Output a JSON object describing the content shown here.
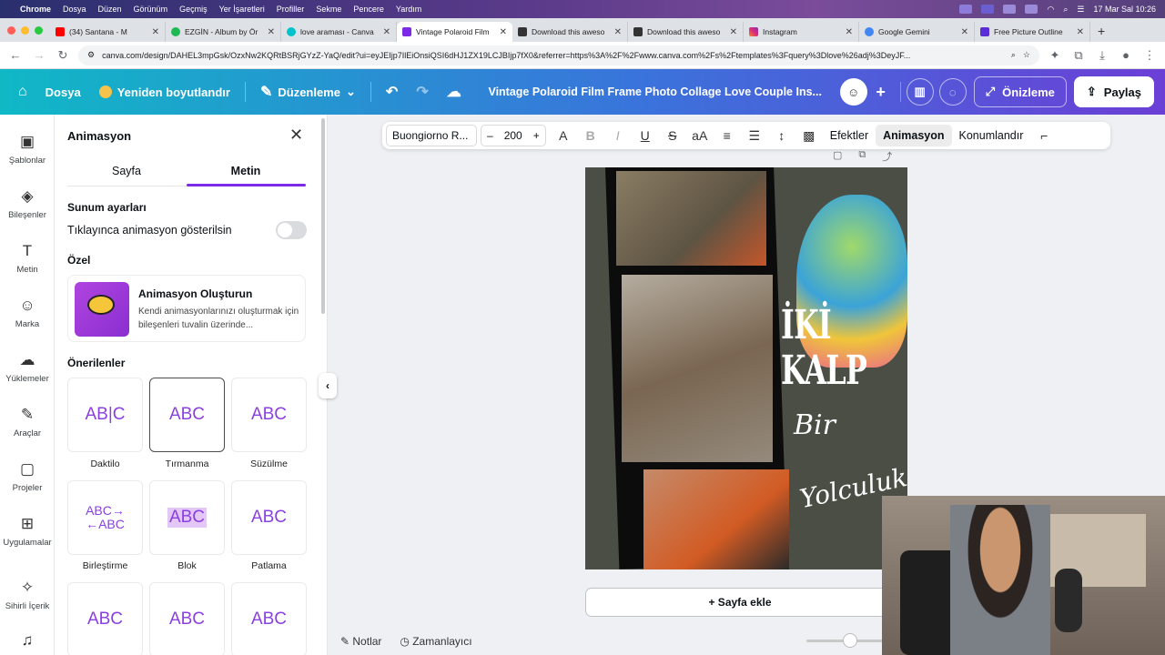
{
  "mac_menu": {
    "apple": "",
    "app": "Chrome",
    "items": [
      "Dosya",
      "Düzen",
      "Görünüm",
      "Geçmiş",
      "Yer İşaretleri",
      "Profiller",
      "Sekme",
      "Pencere",
      "Yardım"
    ],
    "clock": "17 Mar Sal  10:26"
  },
  "tabs": [
    {
      "title": "(34) Santana - M",
      "color": "#ff0000"
    },
    {
      "title": "EZGİN - Album by Ör",
      "color": "#1db954"
    },
    {
      "title": "love araması - Canva",
      "color": "#00c4cc"
    },
    {
      "title": "Vintage Polaroid Film",
      "color": "#7d2ae8",
      "active": true
    },
    {
      "title": "Download this aweso",
      "color": "#333333"
    },
    {
      "title": "Download this aweso",
      "color": "#333333"
    },
    {
      "title": "Instagram",
      "color": "#e1306c"
    },
    {
      "title": "Google Gemini",
      "color": "#4285f4"
    },
    {
      "title": "Free Picture Outline",
      "color": "#5a2dd6"
    }
  ],
  "url": "canva.com/design/DAHEL3mpGsk/OzxNw2KQRtBSRjGYzZ-YaQ/edit?ui=eyJEIjp7IlEiOnsiQSI6dHJ1ZX19LCJBIjp7fX0&referrer=https%3A%2F%2Fwww.canva.com%2Fs%2Ftemplates%3Fquery%3Dlove%26adj%3DeyJF...",
  "header": {
    "file": "Dosya",
    "resize": "Yeniden boyutlandır",
    "edit": "Düzenleme",
    "doc_title": "Vintage Polaroid Film Frame Photo Collage Love Couple Ins...",
    "preview": "Önizleme",
    "share": "Paylaş"
  },
  "rail": [
    {
      "label": "Şablonlar",
      "icon": "▣"
    },
    {
      "label": "Bileşenler",
      "icon": "◈"
    },
    {
      "label": "Metin",
      "icon": "T"
    },
    {
      "label": "Marka",
      "icon": "☺"
    },
    {
      "label": "Yüklemeler",
      "icon": "☁"
    },
    {
      "label": "Araçlar",
      "icon": "✎"
    },
    {
      "label": "Projeler",
      "icon": "▢"
    },
    {
      "label": "Uygulamalar",
      "icon": "⊞"
    },
    {
      "label": "Sihirli İçerik",
      "icon": "✧"
    },
    {
      "label": "",
      "icon": "♫"
    }
  ],
  "panel": {
    "title": "Animasyon",
    "tab_page": "Sayfa",
    "tab_text": "Metin",
    "presentation": "Sunum ayarları",
    "click_label": "Tıklayınca animasyon gösterilsin",
    "custom": "Özel",
    "card_title": "Animasyon Oluşturun",
    "card_desc": "Kendi animasyonlarınızı oluşturmak için bileşenleri tuvalin üzerinde...",
    "suggested": "Önerilenler",
    "tiles": [
      {
        "label": "Daktilo",
        "sample": "AB|C"
      },
      {
        "label": "Tırmanma",
        "sample": "ABC"
      },
      {
        "label": "Süzülme",
        "sample": "ABC"
      },
      {
        "label": "Birleştirme",
        "sample": "ABC→ ←ABC"
      },
      {
        "label": "Blok",
        "sample": "ABC"
      },
      {
        "label": "Patlama",
        "sample": "ABC"
      },
      {
        "label": "",
        "sample": "ABC"
      },
      {
        "label": "",
        "sample": "ABC"
      },
      {
        "label": "",
        "sample": "ABC"
      }
    ]
  },
  "toolbar": {
    "font": "Buongiorno R...",
    "minus": "–",
    "size": "200",
    "plus": "+",
    "effects": "Efektler",
    "animation": "Animasyon",
    "position": "Konumlandır"
  },
  "canvas": {
    "line1": "İKİ",
    "line2": "KALP",
    "script1": "Bir",
    "script2": "Yolculuk"
  },
  "add_page": "+ Sayfa ekle",
  "footer": {
    "notes": "Notlar",
    "timer": "Zamanlayıcı"
  }
}
